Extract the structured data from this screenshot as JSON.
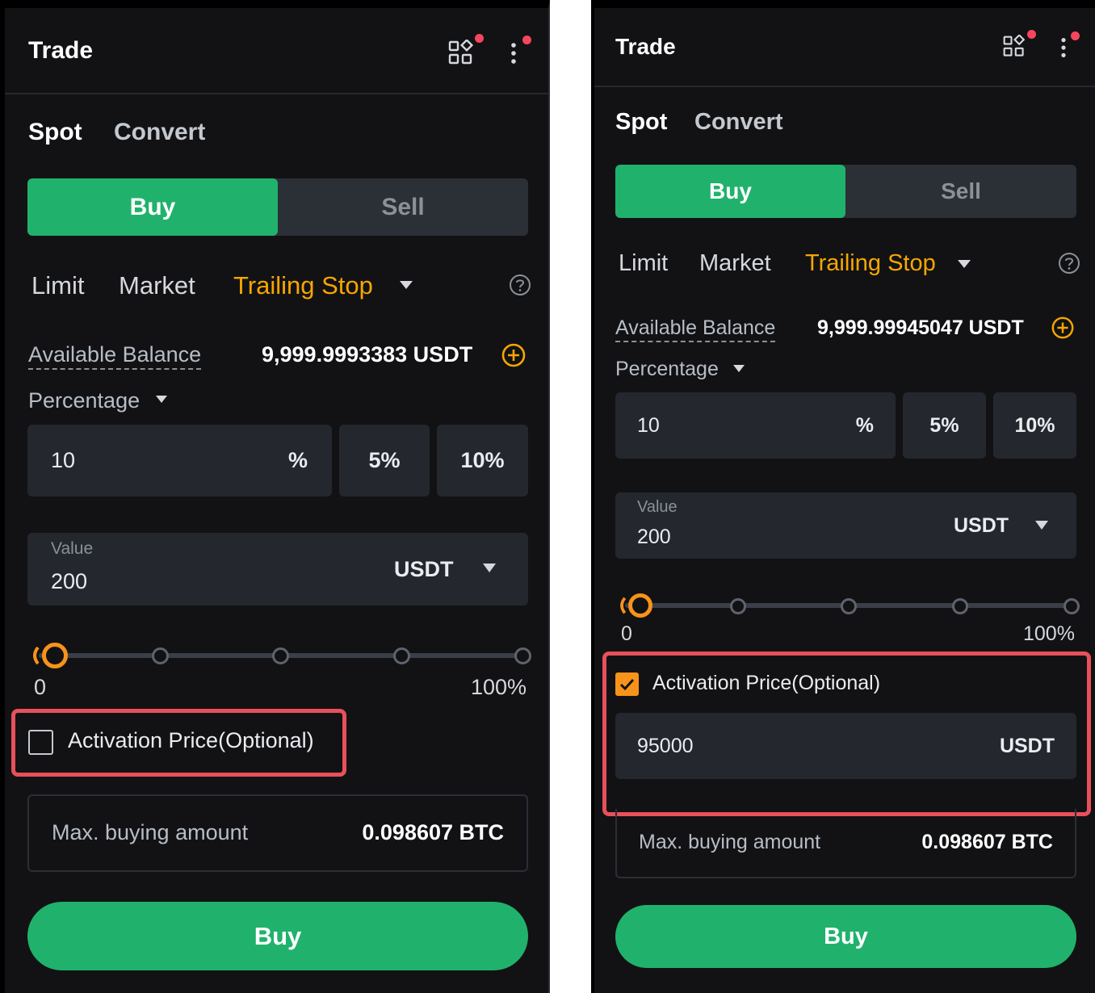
{
  "left": {
    "header": {
      "title": "Trade"
    },
    "tabs": {
      "spot": "Spot",
      "convert": "Convert"
    },
    "side": {
      "buy": "Buy",
      "sell": "Sell"
    },
    "order_types": {
      "limit": "Limit",
      "market": "Market",
      "trailing_stop": "Trailing Stop"
    },
    "balance": {
      "label": "Available Balance",
      "value": "9,999.9993383 USDT"
    },
    "percentage": {
      "label": "Percentage",
      "input_value": "10",
      "unit": "%",
      "preset_1": "5%",
      "preset_2": "10%"
    },
    "value": {
      "label": "Value",
      "amount": "200",
      "currency": "USDT"
    },
    "slider": {
      "min_label": "0",
      "max_label": "100%",
      "position_percent": 0
    },
    "activation": {
      "label": "Activation Price(Optional)",
      "checked": false
    },
    "max_buy": {
      "label": "Max. buying amount",
      "value": "0.098607 BTC"
    },
    "submit": "Buy"
  },
  "right": {
    "header": {
      "title": "Trade"
    },
    "tabs": {
      "spot": "Spot",
      "convert": "Convert"
    },
    "side": {
      "buy": "Buy",
      "sell": "Sell"
    },
    "order_types": {
      "limit": "Limit",
      "market": "Market",
      "trailing_stop": "Trailing Stop"
    },
    "balance": {
      "label": "Available Balance",
      "value": "9,999.99945047 USDT"
    },
    "percentage": {
      "label": "Percentage",
      "input_value": "10",
      "unit": "%",
      "preset_1": "5%",
      "preset_2": "10%"
    },
    "value": {
      "label": "Value",
      "amount": "200",
      "currency": "USDT"
    },
    "slider": {
      "min_label": "0",
      "max_label": "100%",
      "position_percent": 0
    },
    "activation": {
      "label": "Activation Price(Optional)",
      "checked": true,
      "price": "95000",
      "currency": "USDT"
    },
    "max_buy": {
      "label": "Max. buying amount",
      "value": "0.098607 BTC"
    },
    "submit": "Buy"
  },
  "colors": {
    "background": "#121214",
    "buy_green": "#20b26c",
    "accent_orange": "#f7a600",
    "highlight_red": "#e8505b",
    "notification_red": "#f6465d"
  },
  "icons": [
    "apps-grid-icon",
    "more-vertical-icon",
    "notification-dot",
    "caret-down-icon",
    "help-circle-icon",
    "add-circle-icon",
    "checkbox-icon",
    "check-icon"
  ]
}
